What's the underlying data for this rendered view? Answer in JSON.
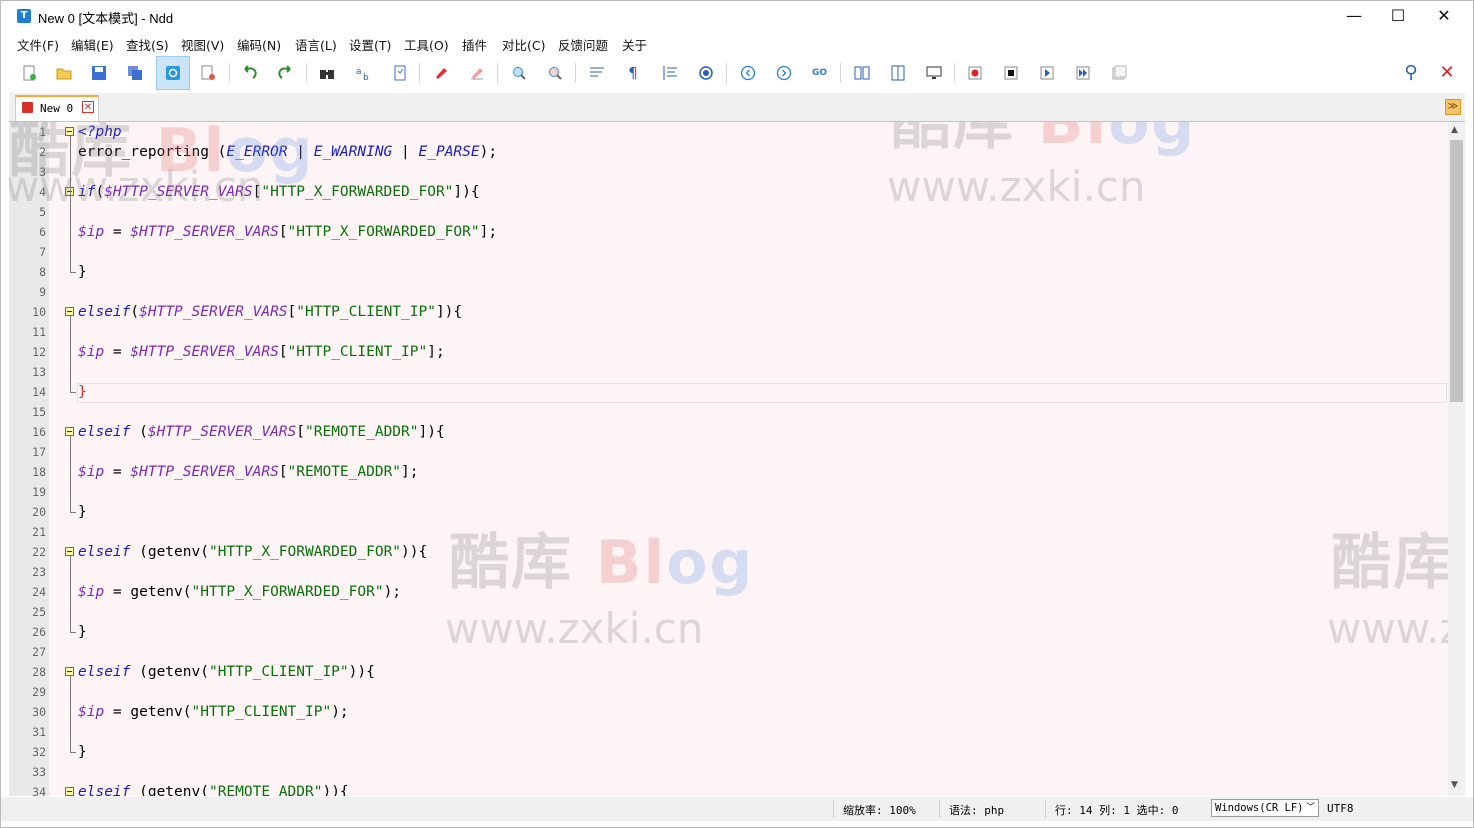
{
  "window": {
    "title": "New 0 [文本模式] - Ndd",
    "app_icon": "T",
    "controls": {
      "minimize": "—",
      "maximize": "☐",
      "close": "✕"
    }
  },
  "menu": [
    "文件(F)",
    "编辑(E)",
    "查找(S)",
    "视图(V)",
    "编码(N)",
    "语言(L)",
    "设置(T)",
    "工具(O)",
    "插件",
    "对比(C)",
    "反馈问题",
    "关于"
  ],
  "toolbar": {
    "icons": [
      "new-file-icon",
      "open-file-icon",
      "save-icon",
      "save-all-icon",
      "text-mode-icon",
      "reload-icon",
      "undo-icon",
      "redo-icon",
      "find-icon",
      "replace-icon",
      "bookmark-icon",
      "mark-icon",
      "clear-mark-icon",
      "zoom-in-icon",
      "zoom-out-icon",
      "word-wrap-icon",
      "show-symbols-icon",
      "indent-guide-icon",
      "target-icon",
      "prev-icon",
      "next-icon",
      "goto-icon",
      "compare-file-icon",
      "compare-dir-icon",
      "monitor-icon",
      "record-macro-icon",
      "stop-macro-icon",
      "play-macro-icon",
      "run-multiple-icon",
      "save-macro-icon"
    ],
    "pin_glyph": "⚲",
    "close_glyph": "✕"
  },
  "tab": {
    "label": "New 0",
    "close_glyph": "✕",
    "menu_glyph": "≫"
  },
  "editor": {
    "lines": [
      {
        "n": "1",
        "tokens": [
          {
            "t": "c",
            "v": "<?php"
          }
        ]
      },
      {
        "n": "2",
        "tokens": [
          {
            "t": "p",
            "v": "error_reporting ("
          },
          {
            "t": "k",
            "v": "E_ERROR"
          },
          {
            "t": "p",
            "v": " | "
          },
          {
            "t": "k",
            "v": "E_WARNING"
          },
          {
            "t": "p",
            "v": " | "
          },
          {
            "t": "k",
            "v": "E_PARSE"
          },
          {
            "t": "p",
            "v": ");"
          }
        ]
      },
      {
        "n": "3",
        "tokens": []
      },
      {
        "n": "4",
        "tokens": [
          {
            "t": "k",
            "v": "if"
          },
          {
            "t": "p",
            "v": "("
          },
          {
            "t": "v",
            "v": "$HTTP_SERVER_VARS"
          },
          {
            "t": "p",
            "v": "["
          },
          {
            "t": "s",
            "v": "\"HTTP_X_FORWARDED_FOR\""
          },
          {
            "t": "p",
            "v": "]){"
          }
        ]
      },
      {
        "n": "5",
        "tokens": []
      },
      {
        "n": "6",
        "tokens": [
          {
            "t": "v",
            "v": "$ip"
          },
          {
            "t": "p",
            "v": " = "
          },
          {
            "t": "v",
            "v": "$HTTP_SERVER_VARS"
          },
          {
            "t": "p",
            "v": "["
          },
          {
            "t": "s",
            "v": "\"HTTP_X_FORWARDED_FOR\""
          },
          {
            "t": "p",
            "v": "];"
          }
        ]
      },
      {
        "n": "7",
        "tokens": []
      },
      {
        "n": "8",
        "tokens": [
          {
            "t": "p",
            "v": "}"
          }
        ]
      },
      {
        "n": "9",
        "tokens": []
      },
      {
        "n": "10",
        "tokens": [
          {
            "t": "k",
            "v": "elseif"
          },
          {
            "t": "p",
            "v": "("
          },
          {
            "t": "v",
            "v": "$HTTP_SERVER_VARS"
          },
          {
            "t": "p",
            "v": "["
          },
          {
            "t": "s",
            "v": "\"HTTP_CLIENT_IP\""
          },
          {
            "t": "p",
            "v": "]){"
          }
        ]
      },
      {
        "n": "11",
        "tokens": []
      },
      {
        "n": "12",
        "tokens": [
          {
            "t": "v",
            "v": "$ip"
          },
          {
            "t": "p",
            "v": " = "
          },
          {
            "t": "v",
            "v": "$HTTP_SERVER_VARS"
          },
          {
            "t": "p",
            "v": "["
          },
          {
            "t": "s",
            "v": "\"HTTP_CLIENT_IP\""
          },
          {
            "t": "p",
            "v": "];"
          }
        ]
      },
      {
        "n": "13",
        "tokens": []
      },
      {
        "n": "14",
        "tokens": [
          {
            "t": "r",
            "v": "}"
          }
        ]
      },
      {
        "n": "15",
        "tokens": []
      },
      {
        "n": "16",
        "tokens": [
          {
            "t": "k",
            "v": "elseif"
          },
          {
            "t": "p",
            "v": " ("
          },
          {
            "t": "v",
            "v": "$HTTP_SERVER_VARS"
          },
          {
            "t": "p",
            "v": "["
          },
          {
            "t": "s",
            "v": "\"REMOTE_ADDR\""
          },
          {
            "t": "p",
            "v": "]){"
          }
        ]
      },
      {
        "n": "17",
        "tokens": []
      },
      {
        "n": "18",
        "tokens": [
          {
            "t": "v",
            "v": "$ip"
          },
          {
            "t": "p",
            "v": " = "
          },
          {
            "t": "v",
            "v": "$HTTP_SERVER_VARS"
          },
          {
            "t": "p",
            "v": "["
          },
          {
            "t": "s",
            "v": "\"REMOTE_ADDR\""
          },
          {
            "t": "p",
            "v": "];"
          }
        ]
      },
      {
        "n": "19",
        "tokens": []
      },
      {
        "n": "20",
        "tokens": [
          {
            "t": "p",
            "v": "}"
          }
        ]
      },
      {
        "n": "21",
        "tokens": []
      },
      {
        "n": "22",
        "tokens": [
          {
            "t": "k",
            "v": "elseif"
          },
          {
            "t": "p",
            "v": " (getenv("
          },
          {
            "t": "s",
            "v": "\"HTTP_X_FORWARDED_FOR\""
          },
          {
            "t": "p",
            "v": ")){"
          }
        ]
      },
      {
        "n": "23",
        "tokens": []
      },
      {
        "n": "24",
        "tokens": [
          {
            "t": "v",
            "v": "$ip"
          },
          {
            "t": "p",
            "v": " = getenv("
          },
          {
            "t": "s",
            "v": "\"HTTP_X_FORWARDED_FOR\""
          },
          {
            "t": "p",
            "v": ");"
          }
        ]
      },
      {
        "n": "25",
        "tokens": []
      },
      {
        "n": "26",
        "tokens": [
          {
            "t": "p",
            "v": "}"
          }
        ]
      },
      {
        "n": "27",
        "tokens": []
      },
      {
        "n": "28",
        "tokens": [
          {
            "t": "k",
            "v": "elseif"
          },
          {
            "t": "p",
            "v": " (getenv("
          },
          {
            "t": "s",
            "v": "\"HTTP_CLIENT_IP\""
          },
          {
            "t": "p",
            "v": ")){"
          }
        ]
      },
      {
        "n": "29",
        "tokens": []
      },
      {
        "n": "30",
        "tokens": [
          {
            "t": "v",
            "v": "$ip"
          },
          {
            "t": "p",
            "v": " = getenv("
          },
          {
            "t": "s",
            "v": "\"HTTP_CLIENT_IP\""
          },
          {
            "t": "p",
            "v": ");"
          }
        ]
      },
      {
        "n": "31",
        "tokens": []
      },
      {
        "n": "32",
        "tokens": [
          {
            "t": "p",
            "v": "}"
          }
        ]
      },
      {
        "n": "33",
        "tokens": []
      },
      {
        "n": "34",
        "tokens": [
          {
            "t": "k",
            "v": "elseif"
          },
          {
            "t": "p",
            "v": " (getenv("
          },
          {
            "t": "s",
            "v": "\"REMOTE_ADDR\""
          },
          {
            "t": "p",
            "v": ")){"
          }
        ]
      }
    ],
    "fold_open_lines": [
      "1",
      "4",
      "10",
      "16",
      "22",
      "28",
      "34"
    ],
    "fold_close_lines": [
      "8",
      "14",
      "20",
      "26",
      "32"
    ],
    "current_line": "14",
    "scroll_up": "▲",
    "scroll_down": "▼"
  },
  "watermark": {
    "logo_cn": "酷库",
    "logo_en_a": "B",
    "logo_en_b": "l",
    "logo_en_c": "og",
    "url": "www.zxki.cn"
  },
  "status": {
    "zoom": "缩放率: 100%",
    "language": "语法: php",
    "position": "行: 14 列: 1 选中: 0",
    "eol": "Windows(CR LF)",
    "encoding": "UTF8"
  },
  "colors": {
    "keyword": "#1919c8",
    "variable": "#7d27b7",
    "string": "#0a6e0a",
    "editor_bg": "#fdf5f5",
    "close_red": "#e02020"
  }
}
